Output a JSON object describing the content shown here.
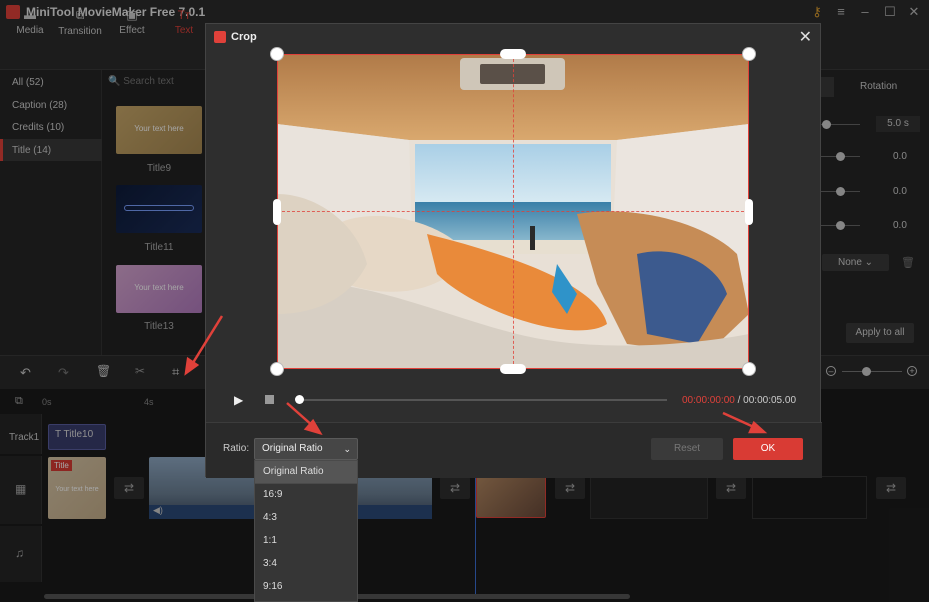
{
  "app": {
    "title": "MiniTool MovieMaker Free 7.0.1"
  },
  "toolbar": {
    "items": [
      {
        "label": "Media",
        "icon": "folder-icon"
      },
      {
        "label": "Transition",
        "icon": "transition-icon"
      },
      {
        "label": "Effect",
        "icon": "effect-icon"
      },
      {
        "label": "Text",
        "icon": "text-icon"
      }
    ]
  },
  "library": {
    "items": [
      {
        "label": "All (52)"
      },
      {
        "label": "Caption (28)"
      },
      {
        "label": "Credits (10)"
      },
      {
        "label": "Title (14)"
      }
    ],
    "active_index": 3
  },
  "search": {
    "placeholder": "Search text"
  },
  "thumbs": [
    {
      "label": "Title9",
      "inner": "Your text here"
    },
    {
      "label": "Title11",
      "inner": ""
    },
    {
      "label": "Title13",
      "inner": "Your text here"
    }
  ],
  "properties": {
    "tab_rotation": "Rotation",
    "duration": "5.0 s",
    "values": [
      "0.0",
      "0.0",
      "0.0"
    ],
    "none_select": "None",
    "apply_all": "Apply to all"
  },
  "timeline": {
    "ruler": [
      "0s",
      "4s"
    ],
    "track1_label": "Track1",
    "title_clip": "Title10",
    "video_title_badge": "Title",
    "video_title_text": "Your text here"
  },
  "dialog": {
    "title": "Crop",
    "time_current": "00:00:00:00",
    "time_separator": " / ",
    "time_total": "00:00:05.00",
    "ratio_label": "Ratio:",
    "ratio_value": "Original Ratio",
    "reset_label": "Reset",
    "ok_label": "OK",
    "progress": 0
  },
  "ratio_options": [
    "Original Ratio",
    "16:9",
    "4:3",
    "1:1",
    "3:4",
    "9:16"
  ],
  "colors": {
    "accent": "#e0413a",
    "ok_button": "#d93b34"
  }
}
